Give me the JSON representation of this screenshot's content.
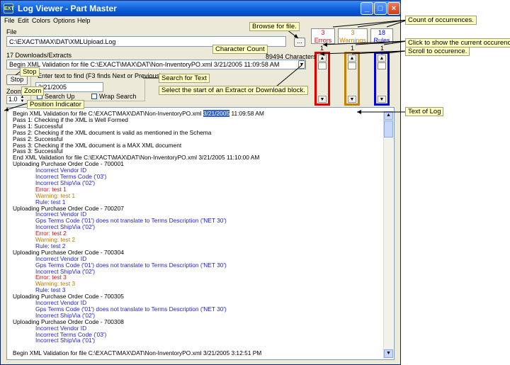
{
  "window": {
    "title": "Log Viewer - Part Master",
    "menu": [
      "File",
      "Edit",
      "Colors",
      "Options",
      "Help"
    ]
  },
  "file_section": {
    "label": "File",
    "path": "C:\\EXACT\\MAX\\DAT\\XMLUpload.Log",
    "browse_label": "..."
  },
  "counters": {
    "errors": {
      "count": "3",
      "label": "Errors",
      "position": "1"
    },
    "warnings": {
      "count": "3",
      "label": "Warnings",
      "position": "1"
    },
    "rules": {
      "count": "18",
      "label": "Rules",
      "position": "1"
    }
  },
  "downloads": {
    "label": "17 Downloads/Extracts",
    "char_count": "89494 Characters",
    "selected": "Begin XML Validation for file C:\\EXACT\\MAX\\DAT\\Non-InventoryPO.xml    3/21/2005 11:09:58 AM"
  },
  "search": {
    "stop_label": "Stop",
    "group_label": "Enter text to find (F3 finds Next or Previous)",
    "text": "3/21/2005",
    "search_up": "Search Up",
    "wrap_search": "Wrap Search"
  },
  "zoom": {
    "label": "Zoom",
    "value": "1.0"
  },
  "log_lines": [
    {
      "indent": 0,
      "color": "#000000",
      "text": "Begin XML Validation for file C:\\EXACT\\MAX\\DAT\\Non-InventoryPO.xml",
      "highlight": "3/21/2005",
      "after": " 11:09:58 AM"
    },
    {
      "indent": 0,
      "color": "#000000",
      "text": "Pass 1: Checking if the XML is Well Formed"
    },
    {
      "indent": 0,
      "color": "#000000",
      "text": "Pass 1: Successful"
    },
    {
      "indent": 0,
      "color": "#000000",
      "text": "Pass 2: Checking if the XML document is valid as mentioned in the Schema"
    },
    {
      "indent": 0,
      "color": "#000000",
      "text": "Pass 2: Successful"
    },
    {
      "indent": 0,
      "color": "#000000",
      "text": "Pass 3: Checking if the XML document is a MAX XML document"
    },
    {
      "indent": 0,
      "color": "#000000",
      "text": "Pass 3: Successful"
    },
    {
      "indent": 0,
      "color": "#000000",
      "text": "End XML Validation for file C:\\EXACT\\MAX\\DAT\\Non-InventoryPO.xml    3/21/2005 11:10:00 AM"
    },
    {
      "indent": 0,
      "color": "#000000",
      "text": "Uploading Purchase Order Code - 700001"
    },
    {
      "indent": 1,
      "color": "#1f1fd0",
      "text": "Incorrect Vendor ID"
    },
    {
      "indent": 1,
      "color": "#1f1fd0",
      "text": "Incorrect Terms Code ('03')"
    },
    {
      "indent": 1,
      "color": "#1f1fd0",
      "text": "Incorrect ShipVia ('02')"
    },
    {
      "indent": 1,
      "color": "#d01010",
      "text": "Error: test 1"
    },
    {
      "indent": 1,
      "color": "#c07800",
      "text": "Warning: test 1"
    },
    {
      "indent": 1,
      "color": "#1f1fd0",
      "text": "Rule: test 1"
    },
    {
      "indent": 0,
      "color": "#000000",
      "text": "Uploading Purchase Order Code - 700207"
    },
    {
      "indent": 1,
      "color": "#1f1fd0",
      "text": "Incorrect Vendor ID"
    },
    {
      "indent": 1,
      "color": "#1f1fd0",
      "text": "Gps Terms Code ('01') does not translate to Terms Description ('NET 30')"
    },
    {
      "indent": 1,
      "color": "#1f1fd0",
      "text": "Incorrect ShipVia ('02')"
    },
    {
      "indent": 1,
      "color": "#d01010",
      "text": "Error: test 2"
    },
    {
      "indent": 1,
      "color": "#c07800",
      "text": "Warning: test 2"
    },
    {
      "indent": 1,
      "color": "#1f1fd0",
      "text": "Rule: test 2"
    },
    {
      "indent": 0,
      "color": "#000000",
      "text": "Uploading Purchase Order Code - 700304"
    },
    {
      "indent": 1,
      "color": "#1f1fd0",
      "text": "Incorrect Vendor ID"
    },
    {
      "indent": 1,
      "color": "#1f1fd0",
      "text": "Gps Terms Code ('01') does not translate to Terms Description ('NET 30')"
    },
    {
      "indent": 1,
      "color": "#1f1fd0",
      "text": "Incorrect ShipVia ('02')"
    },
    {
      "indent": 1,
      "color": "#d01010",
      "text": "Error: test 3"
    },
    {
      "indent": 1,
      "color": "#c07800",
      "text": "Warning: test 3"
    },
    {
      "indent": 1,
      "color": "#1f1fd0",
      "text": "Rule: test 3"
    },
    {
      "indent": 0,
      "color": "#000000",
      "text": "Uploading Purchase Order Code - 700305"
    },
    {
      "indent": 1,
      "color": "#1f1fd0",
      "text": "Incorrect Vendor ID"
    },
    {
      "indent": 1,
      "color": "#1f1fd0",
      "text": "Gps Terms Code ('01') does not translate to Terms Description ('NET 30')"
    },
    {
      "indent": 1,
      "color": "#1f1fd0",
      "text": "Incorrect ShipVia ('02')"
    },
    {
      "indent": 0,
      "color": "#000000",
      "text": "Uploading Purchase Order Code - 700308"
    },
    {
      "indent": 1,
      "color": "#1f1fd0",
      "text": "Incorrect Vendor ID"
    },
    {
      "indent": 1,
      "color": "#1f1fd0",
      "text": "Incorrect Terms Code ('03')"
    },
    {
      "indent": 1,
      "color": "#1f1fd0",
      "text": "Incorrect ShipVia ('01')"
    },
    {
      "indent": 0,
      "color": "#000000",
      "text": ""
    },
    {
      "indent": 0,
      "color": "#000000",
      "text": "Begin XML Validation for file C:\\EXACT\\MAX\\DAT\\Non-InventoryPO.xml    3/21/2005 3:12:51 PM"
    }
  ],
  "callouts": {
    "browse": "Browse for file.",
    "count": "Count of occurrences.",
    "show_current": "Click to show the current occurence.",
    "scroll": "Scroll to occurence.",
    "char_count": "Character Count",
    "stop": "Stop",
    "search_text": "Search for Text",
    "select_start": "Select the start of an Extract or Download block.",
    "zoom": "Zoom",
    "position": "Position Indicator",
    "text_of_log": "Text of Log"
  },
  "colors": {
    "errors": "#e00000",
    "warnings": "#c08000",
    "rules": "#0000e0",
    "highlight": "#3163c6"
  }
}
